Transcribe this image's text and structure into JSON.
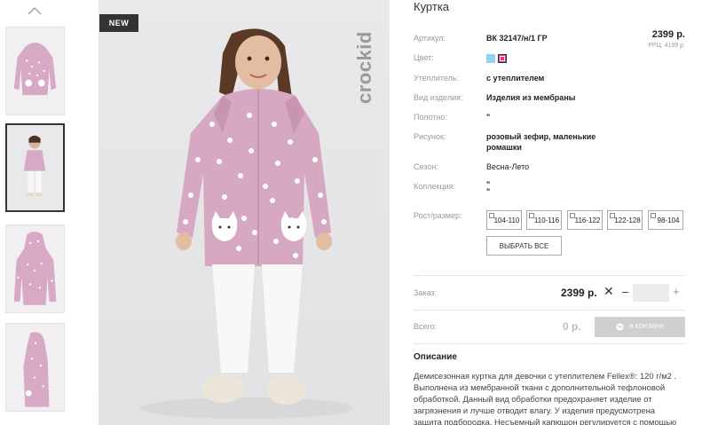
{
  "product": {
    "title": "Куртка",
    "badge": "NEW",
    "brand": "crockid",
    "price": "2399 р.",
    "rrp": "РРЦ: 4199 р."
  },
  "details": {
    "article_label": "Артикул:",
    "article_value": "ВК 32147/н/1 ГР",
    "color_label": "Цвет:",
    "colors": [
      "#8fd3f4",
      "#e0348c"
    ],
    "insulation_label": "Утеплитель:",
    "insulation_value": "с утеплителем",
    "type_label": "Вид изделия:",
    "type_value": "Изделия из мембраны",
    "fabric_label": "Полотно:",
    "fabric_value": "\"",
    "pattern_label": "Рисунок:",
    "pattern_value_1": "розовый зефир, маленькие",
    "pattern_value_2": "ромашки",
    "season_label": "Сезон:",
    "season_value": "Весна-Лето",
    "collection_label": "Коллекция:",
    "collection_value_1": "\"",
    "collection_value_2": "\""
  },
  "sizes": {
    "label": "Рост/размер:",
    "options": [
      "104-110",
      "110-116",
      "116-122",
      "122-128",
      "98-104"
    ],
    "select_all": "ВЫБРАТЬ ВСЕ"
  },
  "order": {
    "label": "Заказ:",
    "price": "2399 р.",
    "remove_symbol": "✕",
    "minus": "–",
    "plus": "+",
    "quantity": ""
  },
  "total": {
    "label": "Всего:",
    "value": "0 р.",
    "cart_button": "В КОРЗИНУ"
  },
  "description": {
    "heading": "Описание",
    "text": "Демисезонная куртка для девочки с утеплителем Fellex®: 120 г/м2 . Выполнена из мембранной ткани с дополнительной тефлоновой обработкой. Данный вид обработки предохраняет изделие от загрязнения и лучше отводит влагу. У изделия предусмотрена защита подбородка. Несъемный капюшон регулируется с помощью"
  }
}
